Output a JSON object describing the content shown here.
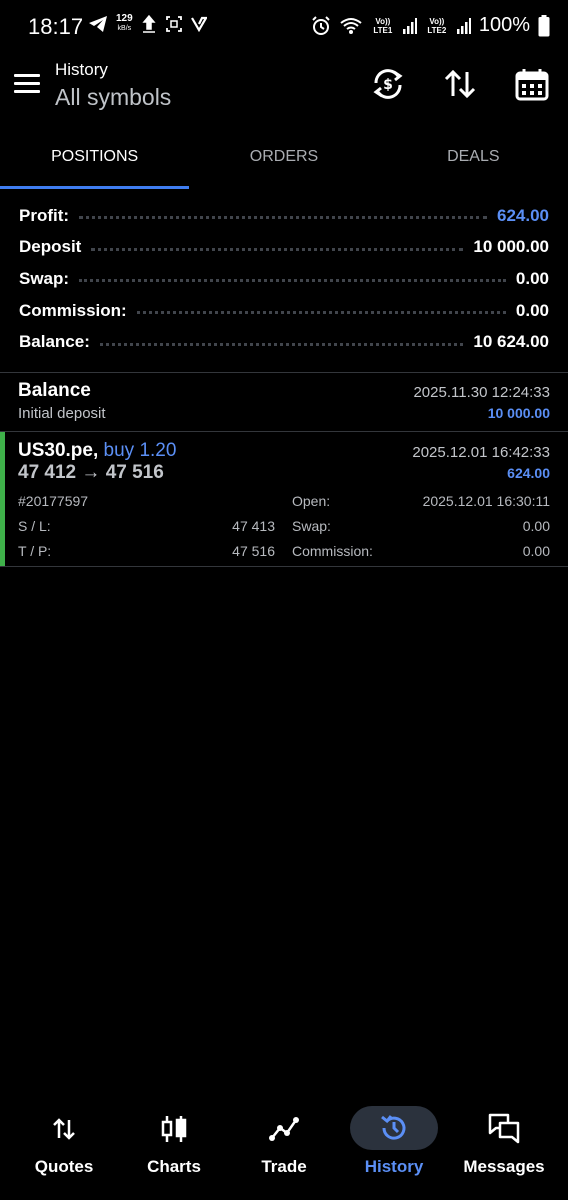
{
  "status_bar": {
    "time": "18:17",
    "speed_value": "129",
    "speed_unit": "kB/s",
    "sim1_label": "Vo)) LTE1",
    "sim2_label": "Vo)) LTE2",
    "battery": "100%"
  },
  "header": {
    "title": "History",
    "subtitle": "All symbols",
    "icons": [
      "currency-exchange-icon",
      "sort-icon",
      "calendar-icon"
    ]
  },
  "tabs": [
    {
      "label": "POSITIONS",
      "active": true
    },
    {
      "label": "ORDERS",
      "active": false
    },
    {
      "label": "DEALS",
      "active": false
    }
  ],
  "summary": [
    {
      "label": "Profit:",
      "value": "624.00",
      "highlight": true
    },
    {
      "label": "Deposit",
      "value": "10 000.00",
      "highlight": false
    },
    {
      "label": "Swap:",
      "value": "0.00",
      "highlight": false
    },
    {
      "label": "Commission:",
      "value": "0.00",
      "highlight": false
    },
    {
      "label": "Balance:",
      "value": "10 624.00",
      "highlight": false
    }
  ],
  "balance_entry": {
    "title": "Balance",
    "description": "Initial deposit",
    "time": "2025.11.30 12:24:33",
    "amount": "10 000.00"
  },
  "position": {
    "symbol": "US30.pe,",
    "direction": "buy 1.20",
    "price_open": "47 412",
    "arrow": "→",
    "price_close": "47 516",
    "close_time": "2025.12.01 16:42:33",
    "profit": "624.00",
    "ticket": "#20177597",
    "open_label": "Open:",
    "open_time": "2025.12.01 16:30:11",
    "sl_label": "S / L:",
    "sl_value": "47 413",
    "swap_label": "Swap:",
    "swap_value": "0.00",
    "tp_label": "T / P:",
    "tp_value": "47 516",
    "commission_label": "Commission:",
    "commission_value": "0.00",
    "bar_color": "#3fb14a"
  },
  "bottom_nav": [
    {
      "label": "Quotes",
      "icon": "quotes-icon",
      "active": false
    },
    {
      "label": "Charts",
      "icon": "candlestick-icon",
      "active": false
    },
    {
      "label": "Trade",
      "icon": "trade-line-icon",
      "active": false
    },
    {
      "label": "History",
      "icon": "history-icon",
      "active": true
    },
    {
      "label": "Messages",
      "icon": "messages-icon",
      "active": false
    }
  ],
  "colors": {
    "accent": "#3f7df0",
    "profit_blue": "#5b8ff5",
    "buy_green": "#3fb14a",
    "background": "#000000"
  }
}
